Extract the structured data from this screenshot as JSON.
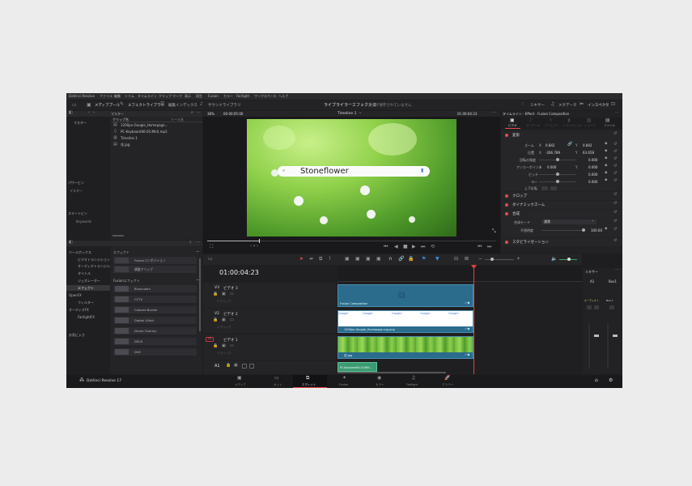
{
  "menubar": {
    "items": [
      "DaVinci Resolve",
      "ファイル",
      "編集",
      "トリム",
      "タイムライン",
      "クリップ",
      "マーク",
      "表示",
      "再生",
      "Fusion",
      "カラー",
      "Fairlight",
      "ワークスペース",
      "ヘルプ"
    ]
  },
  "toolbar": {
    "media_pool": "メディアプール",
    "effects_library": "エフェクトライブラリ",
    "edit_index": "編集インデックス",
    "sound_library": "サウンドライブラリ",
    "project_title": "ライブライラーエフェクト 2",
    "save_status": "変更が保存されていません",
    "mixer": "ミキサー",
    "metadata": "メタデータ",
    "inspector": "インスペクタ"
  },
  "media_pool": {
    "bin_header": "マスター",
    "master_bin": "マスター",
    "column_name": "クリップ名",
    "column_reel": "リール名",
    "items": [
      "1200px-Google_Homepage...",
      "PC-Keyboard06-01(Mid).mp3",
      "Timeline 1",
      "花.jpg"
    ],
    "power_bins": "パワービン",
    "power_master": "マスター",
    "smart_bins": "スマートビン",
    "keywords": "Keywords"
  },
  "viewer": {
    "zoom": "38%",
    "source_tc": "00:00:05:00",
    "timeline_name": "Timeline 1",
    "record_tc": "01:00:04:23",
    "search_text": "Stoneflower"
  },
  "inspector": {
    "title": "タイムライン - Effect - Fusion Composition",
    "tabs": [
      "ビデオ",
      "オーディオ",
      "エフェクト",
      "トランジション",
      "イメージ",
      "ファイル"
    ],
    "transform": "変形",
    "zoom_label": "ズーム",
    "zoom_x": "0.842",
    "zoom_y": "0.842",
    "position_label": "位置",
    "pos_x": "-266.789",
    "pos_y": "63.658",
    "rotation_label": "回転の角度",
    "rotation": "0.000",
    "anchor_label": "アンカーポイント",
    "anchor_x": "0.000",
    "anchor_y": "0.000",
    "pitch_label": "ピッチ",
    "pitch": "0.000",
    "yaw_label": "ヨー",
    "yaw": "0.000",
    "flip_label": "上下反転",
    "crop": "クロップ",
    "dynamic_zoom": "ダイナミックズーム",
    "composite": "合成",
    "composite_mode_label": "合成モード",
    "composite_mode": "通常",
    "opacity_label": "不透明度",
    "opacity": "100.00",
    "stabilization": "スタビライゼーション"
  },
  "effects": {
    "toolbox": "ツールボックス",
    "video_transitions": "ビデオトランジション",
    "audio_transitions": "オーディオトランジション",
    "titles": "タイトル",
    "generators": "ジェネレーター",
    "effects": "エフェクト",
    "openfx": "OpenFX",
    "filters": "フィルター",
    "audio_fx": "オーディオFX",
    "fairlight_fx": "FairlightFX",
    "favorites": "お気に入り",
    "effects_header": "エフェクト",
    "fusion_comp": "Fusionコンポジション",
    "adjustment_clip": "調整クリップ",
    "fusion_effects": "Fusionエフェクト",
    "fx_items": [
      "Binoculars",
      "CCTV",
      "Colored Border",
      "Digital Glitch",
      "Drone Overlay",
      "DSLR",
      "DVE"
    ]
  },
  "timeline": {
    "timecode": "01:00:04:23",
    "tracks": [
      {
        "id": "V3",
        "name": "ビデオ 3",
        "clips": "1 クリップ"
      },
      {
        "id": "V2",
        "name": "ビデオ 2",
        "clips": "1 クリップ"
      },
      {
        "id": "V1",
        "name": "ビデオ 1",
        "clips": "1 クリップ"
      },
      {
        "id": "A1",
        "name": "",
        "clips": ""
      }
    ],
    "clip_fusion": "Fusion Composition",
    "clip_google": "1200px-Google_Homepage.svg.png",
    "clip_flower": "花.jpg",
    "clip_audio": "PC-Keyboard06-01(Mid...",
    "google_word": "Google"
  },
  "mixer": {
    "title": "ミキサー",
    "a1": "A1",
    "bus1": "Bus1",
    "bus_label": "Bus 1",
    "audio_label": "オーディオ 1"
  },
  "pagebar": {
    "app": "DaVinci Resolve 17",
    "pages": [
      "メディア",
      "カット",
      "エディット",
      "Fusion",
      "カラー",
      "Fairlight",
      "デリバー"
    ],
    "active_index": 2
  },
  "colors": {
    "accent_red": "#e64b4b",
    "fusion_clip": "#2e6f90",
    "video_clip": "#2e6f90",
    "audio_clip": "#3b9a73",
    "playhead": "#e0443c"
  }
}
